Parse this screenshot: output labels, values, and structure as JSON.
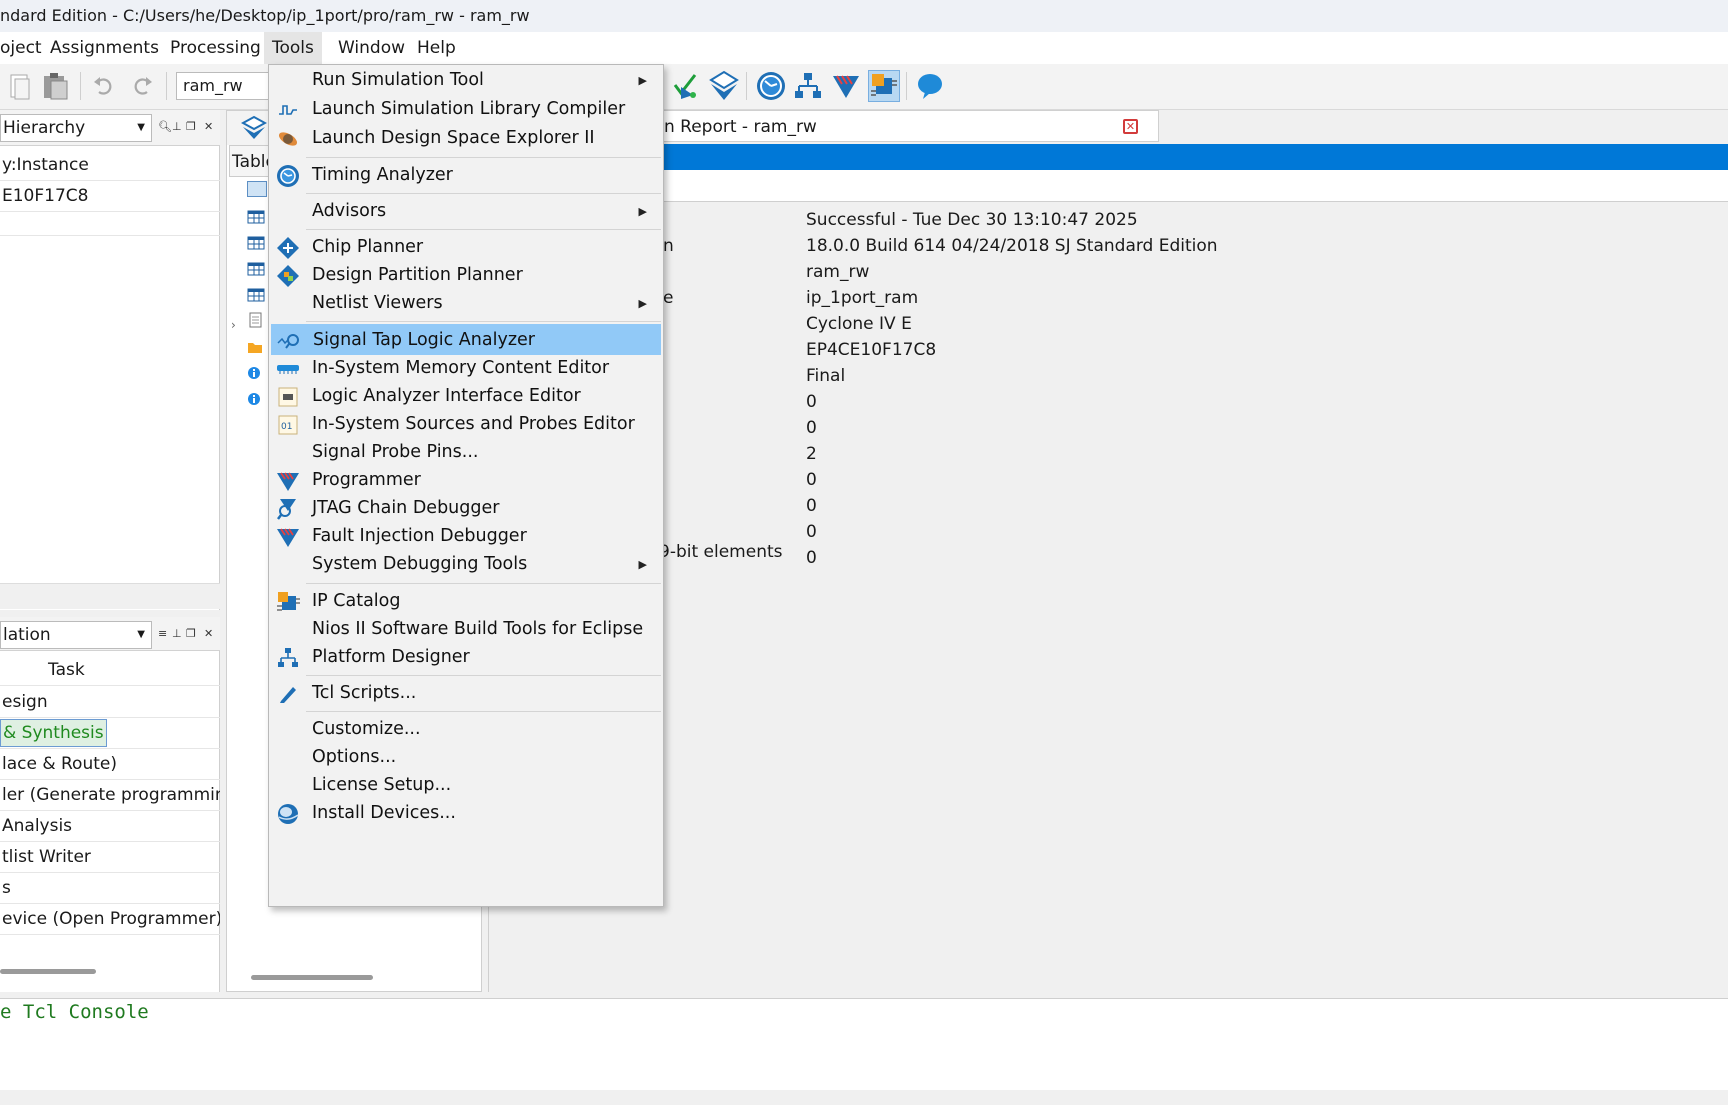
{
  "window": {
    "title": "ndard Edition - C:/Users/he/Desktop/ip_1port/pro/ram_rw - ram_rw"
  },
  "menubar": {
    "items": [
      "oject",
      "Assignments",
      "Processing",
      "Tools",
      "Window",
      "Help"
    ]
  },
  "toolbar": {
    "revision": "ram_rw"
  },
  "hierarchy": {
    "combo": "Hierarchy",
    "rows": [
      "y:Instance",
      "E10F17C8"
    ]
  },
  "tasks": {
    "combo": "lation",
    "header": "Task",
    "rows": [
      "esign",
      " & Synthesis",
      "lace & Route)",
      "ler (Generate programming",
      "Analysis",
      "tlist Writer",
      "s",
      "evice (Open Programmer)"
    ]
  },
  "middle": {
    "table_label": "Table"
  },
  "report": {
    "tab_label": "n Report - ram_rw",
    "labels": [
      "n",
      "e",
      "9-bit elements"
    ],
    "values": [
      "Successful - Tue Dec 30 13:10:47 2025",
      "18.0.0 Build 614 04/24/2018 SJ Standard Edition",
      "ram_rw",
      "ip_1port_ram",
      "Cyclone IV E",
      "EP4CE10F17C8",
      "Final",
      "0",
      "0",
      "2",
      "0",
      "0",
      "0",
      "0"
    ]
  },
  "console": {
    "text": "e Tcl Console"
  },
  "tools_menu": {
    "items": [
      {
        "label": "Run Simulation Tool",
        "icon": "none",
        "submenu": true
      },
      {
        "label": "Launch Simulation Library Compiler",
        "icon": "waveform-icon",
        "submenu": false
      },
      {
        "label": "Launch Design Space Explorer II",
        "icon": "satellite-icon",
        "submenu": false
      },
      {
        "label": "Timing Analyzer",
        "icon": "clock-icon",
        "submenu": false
      },
      {
        "label": "Advisors",
        "icon": "none",
        "submenu": true
      },
      {
        "label": "Chip Planner",
        "icon": "chip-planner-icon",
        "submenu": false
      },
      {
        "label": "Design Partition Planner",
        "icon": "partition-icon",
        "submenu": false
      },
      {
        "label": "Netlist Viewers",
        "icon": "none",
        "submenu": true
      },
      {
        "label": "Signal Tap Logic Analyzer",
        "icon": "signal-tap-icon",
        "submenu": false,
        "highlighted": true
      },
      {
        "label": "In-System Memory Content Editor",
        "icon": "memory-icon",
        "submenu": false
      },
      {
        "label": "Logic Analyzer Interface Editor",
        "icon": "lai-icon",
        "submenu": false
      },
      {
        "label": "In-System Sources and Probes Editor",
        "icon": "sources-probes-icon",
        "submenu": false
      },
      {
        "label": "Signal Probe Pins...",
        "icon": "none",
        "submenu": false
      },
      {
        "label": "Programmer",
        "icon": "programmer-icon",
        "submenu": false
      },
      {
        "label": "JTAG Chain Debugger",
        "icon": "jtag-icon",
        "submenu": false
      },
      {
        "label": "Fault Injection Debugger",
        "icon": "fault-injection-icon",
        "submenu": false
      },
      {
        "label": "System Debugging Tools",
        "icon": "none",
        "submenu": true
      },
      {
        "label": "IP Catalog",
        "icon": "ip-catalog-icon",
        "submenu": false
      },
      {
        "label": "Nios II Software Build Tools for Eclipse",
        "icon": "none",
        "submenu": false
      },
      {
        "label": "Platform Designer",
        "icon": "platform-designer-icon",
        "submenu": false
      },
      {
        "label": "Tcl Scripts...",
        "icon": "tcl-pen-icon",
        "submenu": false
      },
      {
        "label": "Customize...",
        "icon": "none",
        "submenu": false
      },
      {
        "label": "Options...",
        "icon": "none",
        "submenu": false
      },
      {
        "label": "License Setup...",
        "icon": "none",
        "submenu": false
      },
      {
        "label": "Install Devices...",
        "icon": "globe-icon",
        "submenu": false
      }
    ]
  }
}
